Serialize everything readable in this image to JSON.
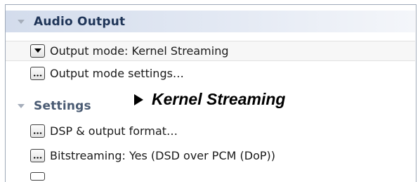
{
  "audio_output": {
    "title": "Audio Output",
    "output_mode": {
      "label": "Output mode: Kernel Streaming",
      "icon": "dropdown-arrow-icon"
    },
    "output_mode_settings": {
      "label": "Output mode settings…",
      "icon": "ellipsis-icon"
    }
  },
  "settings": {
    "title": "Settings",
    "items": [
      {
        "label": "DSP & output format…",
        "icon": "ellipsis-icon"
      },
      {
        "label": "Bitstreaming: Yes (DSD over PCM (DoP))",
        "icon": "ellipsis-icon"
      }
    ]
  },
  "annotation": {
    "text": "Kernel Streaming"
  },
  "colors": {
    "header_gradient_start": "#d3dcec",
    "header_title": "#1f3558",
    "frame_border": "#9fa9b8",
    "selected_row": "#f7f7f7"
  }
}
